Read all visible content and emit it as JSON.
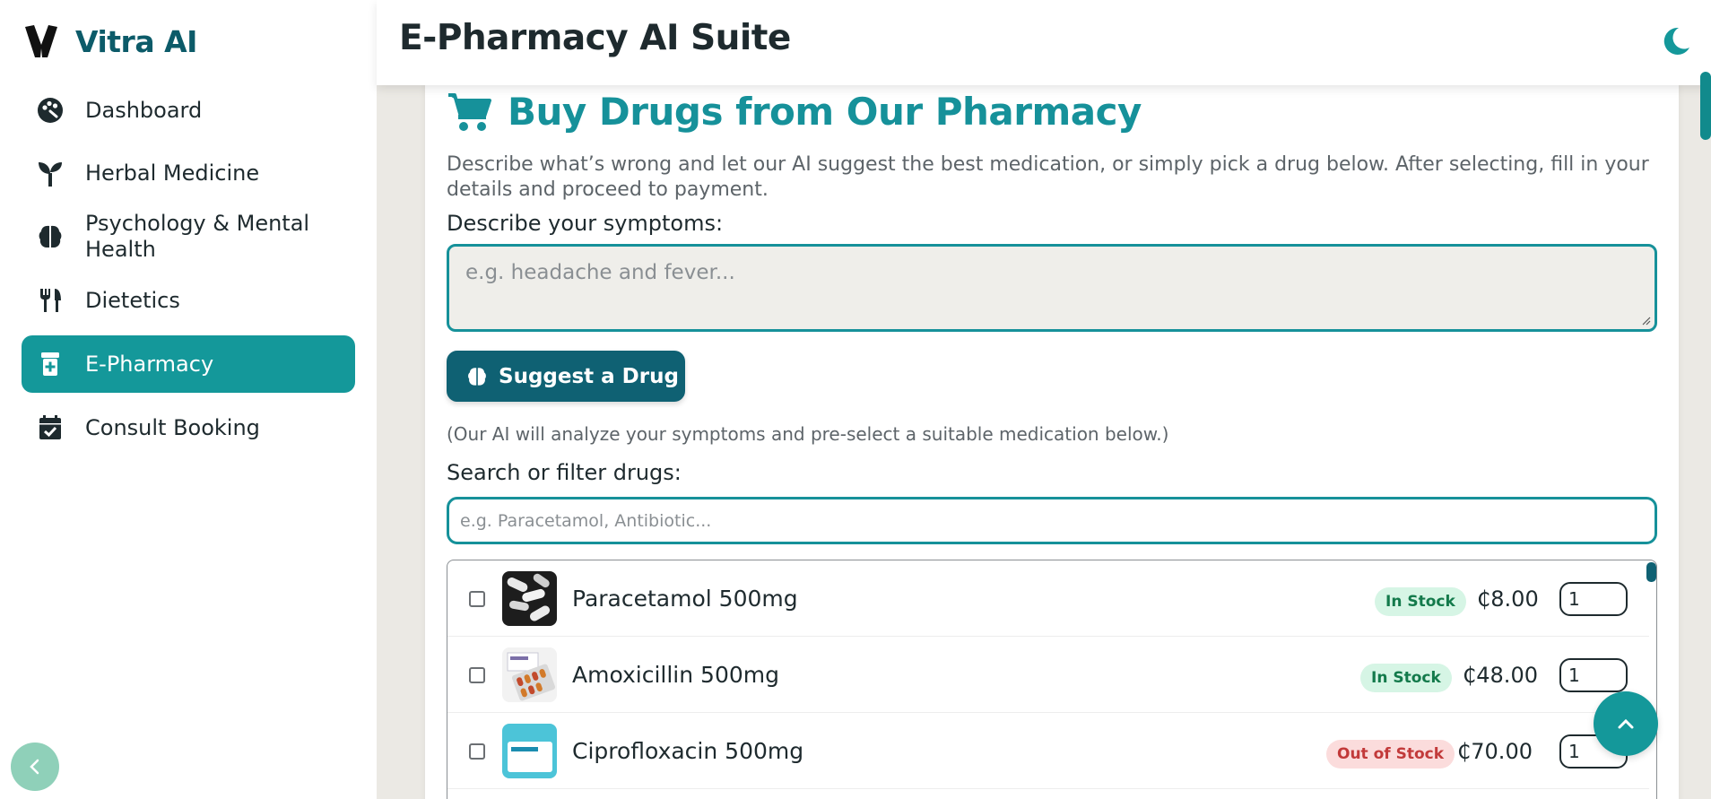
{
  "app": {
    "name": "Vitra AI",
    "header_title": "E-Pharmacy AI Suite"
  },
  "sidebar": {
    "items": [
      {
        "label": "Dashboard",
        "icon": "palette-icon",
        "active": false
      },
      {
        "label": "Herbal Medicine",
        "icon": "seedling-icon",
        "active": false
      },
      {
        "label": "Psychology & Mental Health",
        "icon": "brain-icon",
        "active": false
      },
      {
        "label": "Dietetics",
        "icon": "utensils-icon",
        "active": false
      },
      {
        "label": "E-Pharmacy",
        "icon": "prescription-bottle-icon",
        "active": true
      },
      {
        "label": "Consult Booking",
        "icon": "calendar-check-icon",
        "active": false
      }
    ]
  },
  "pharmacy": {
    "title": "Buy Drugs from Our Pharmacy",
    "description": "Describe what’s wrong and let our AI suggest the best medication, or simply pick a drug below. After selecting, fill in your details and proceed to payment.",
    "symptoms_label": "Describe your symptoms:",
    "symptoms_placeholder": "e.g. headache and fever...",
    "suggest_button": "Suggest a Drug",
    "hint": "(Our AI will analyze your symptoms and pre-select a suitable medication below.)",
    "search_label": "Search or filter drugs:",
    "search_placeholder": "e.g. Paracetamol, Antibiotic...",
    "drugs": [
      {
        "name": "Paracetamol 500mg",
        "stock": "In Stock",
        "price": "₵8.00",
        "qty": "1"
      },
      {
        "name": "Amoxicillin 500mg",
        "stock": "In Stock",
        "price": "₵48.00",
        "qty": "1"
      },
      {
        "name": "Ciprofloxacin 500mg",
        "stock": "Out of Stock",
        "price": "₵70.00",
        "qty": "1"
      }
    ]
  },
  "colors": {
    "accent": "#14989a",
    "brand": "#0c5b69",
    "primary_button": "#0f6173",
    "in_stock_bg": "#d6f5e5",
    "out_stock_bg": "#fbdcdc"
  }
}
